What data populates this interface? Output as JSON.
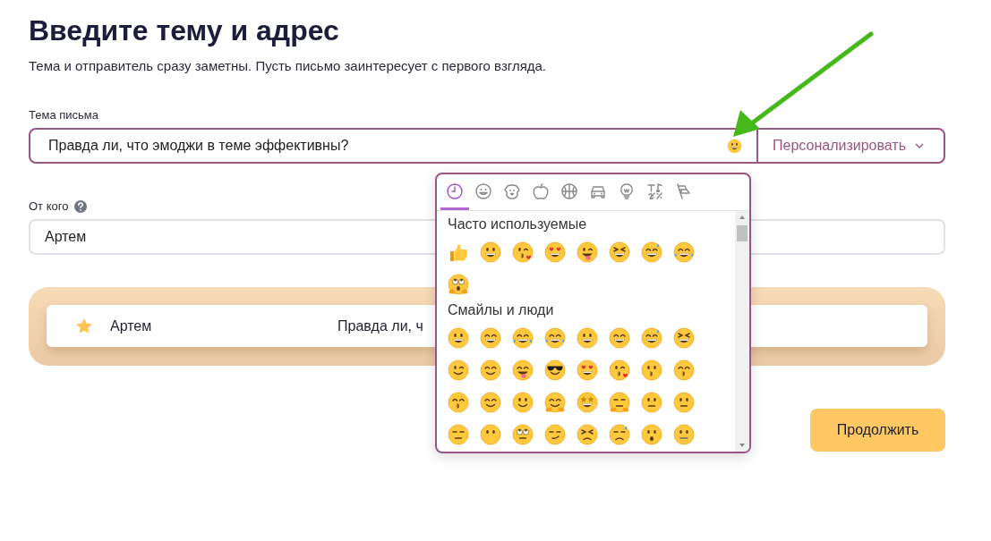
{
  "heading": {
    "title": "Введите тему и адрес",
    "subtitle": "Тема и отправитель сразу заметны. Пусть письмо заинтересует с первого взгляда."
  },
  "subject": {
    "label": "Тема письма",
    "value": "Правда ли, что эмоджи в теме эффективны?",
    "focused": true,
    "personalize": "Персонализировать"
  },
  "sender": {
    "label": "От кого",
    "value": "Артем"
  },
  "preview": {
    "starred": true,
    "sender": "Артем",
    "subject": "Правда ли, ч"
  },
  "continue_button": "Продолжить",
  "emoji_picker": {
    "open": true,
    "tabs": [
      {
        "kind": "clock",
        "selected": true
      },
      {
        "kind": "smiley",
        "selected": false
      },
      {
        "kind": "dog",
        "selected": false
      },
      {
        "kind": "apple",
        "selected": false
      },
      {
        "kind": "ball",
        "selected": false
      },
      {
        "kind": "car",
        "selected": false
      },
      {
        "kind": "bulb",
        "selected": false
      },
      {
        "kind": "symbols",
        "selected": false
      },
      {
        "kind": "flag",
        "selected": false
      }
    ],
    "sections": [
      {
        "title": "Часто используемые",
        "emojis": [
          {
            "kind": "thumb"
          },
          {
            "kind": "grin"
          },
          {
            "kind": "kiss-heart"
          },
          {
            "kind": "heart-eyes"
          },
          {
            "kind": "wink-tongue"
          },
          {
            "kind": "squint"
          },
          {
            "kind": "sweat-smile"
          },
          {
            "kind": "joy"
          },
          {
            "kind": "scream"
          }
        ]
      },
      {
        "title": "Смайлы и люди",
        "emojis": [
          {
            "kind": "grin"
          },
          {
            "kind": "grin-teeth"
          },
          {
            "kind": "joy"
          },
          {
            "kind": "rofl"
          },
          {
            "kind": "smiley"
          },
          {
            "kind": "smile-closed"
          },
          {
            "kind": "sweat-smile"
          },
          {
            "kind": "squint"
          },
          {
            "kind": "wink"
          },
          {
            "kind": "blush"
          },
          {
            "kind": "yum"
          },
          {
            "kind": "cool"
          },
          {
            "kind": "heart-eyes"
          },
          {
            "kind": "kiss-heart"
          },
          {
            "kind": "kiss"
          },
          {
            "kind": "kiss-closed"
          },
          {
            "kind": "kiss-smile"
          },
          {
            "kind": "relieved"
          },
          {
            "kind": "slight"
          },
          {
            "kind": "hug"
          },
          {
            "kind": "star-eyes"
          },
          {
            "kind": "think"
          },
          {
            "kind": "raised-brow"
          },
          {
            "kind": "neutral"
          },
          {
            "kind": "expressionless"
          },
          {
            "kind": "no-mouth"
          },
          {
            "kind": "eye-roll"
          },
          {
            "kind": "smirk"
          },
          {
            "kind": "persevere"
          },
          {
            "kind": "sad-sweat"
          },
          {
            "kind": "hushed"
          },
          {
            "kind": "zipper"
          }
        ]
      }
    ]
  }
}
